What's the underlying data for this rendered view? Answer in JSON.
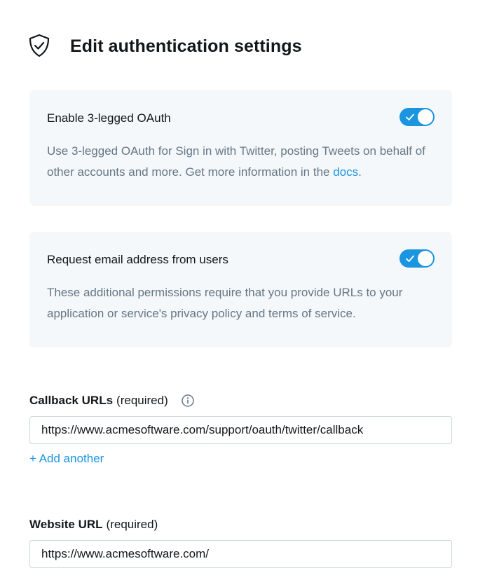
{
  "header": {
    "icon": "shield-check-icon",
    "title": "Edit authentication settings"
  },
  "oauth_card": {
    "title": "Enable 3-legged OAuth",
    "description_prefix": "Use 3-legged OAuth for Sign in with Twitter, posting Tweets on behalf of other accounts and more. Get more information in the ",
    "link_text": "docs",
    "description_suffix": ".",
    "toggle_on": true
  },
  "email_card": {
    "title": "Request email address from users",
    "description": "These additional permissions require that you provide URLs to your application or service's privacy policy and terms of service.",
    "toggle_on": true
  },
  "callback": {
    "label": "Callback URLs",
    "required": "(required)",
    "info_icon": "info-icon",
    "value": "https://www.acmesoftware.com/support/oauth/twitter/callback",
    "add_another": "+ Add another"
  },
  "website": {
    "label": "Website URL",
    "required": "(required)",
    "value": "https://www.acmesoftware.com/"
  },
  "colors": {
    "accent": "#1b95e0",
    "card_background": "#f5f8fa",
    "muted_text": "#657786",
    "border": "#ccd6dd"
  }
}
